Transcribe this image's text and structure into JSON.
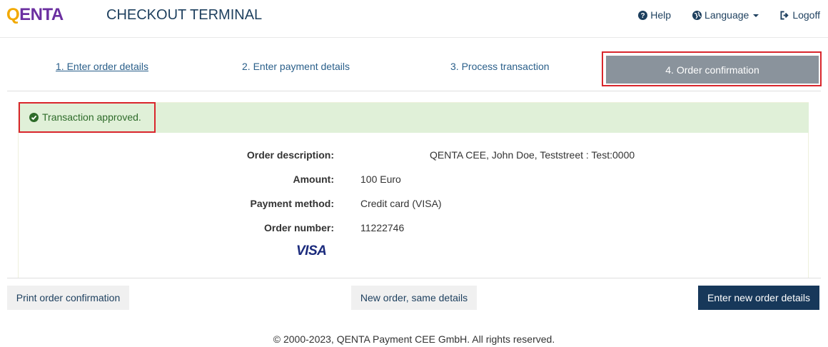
{
  "brand": {
    "logo_q": "Q",
    "logo_rest": "ENTA",
    "title": "CHECKOUT TERMINAL"
  },
  "nav": {
    "help": {
      "label": "Help",
      "icon": "question-circle-icon"
    },
    "language": {
      "label": "Language",
      "icon": "globe-icon"
    },
    "logoff": {
      "label": "Logoff",
      "icon": "sign-out-icon"
    }
  },
  "steps": [
    {
      "label": "1. Enter order details",
      "state": "done"
    },
    {
      "label": "2. Enter payment details",
      "state": "pending"
    },
    {
      "label": "3. Process transaction",
      "state": "pending"
    },
    {
      "label": "4. Order confirmation",
      "state": "active"
    }
  ],
  "alert": {
    "text": "Transaction approved.",
    "icon": "check-circle-icon",
    "color": "#2e6b2a"
  },
  "details": [
    {
      "label": "Order description:",
      "value": "QENTA CEE, John Doe, Teststreet : Test:0000"
    },
    {
      "label": "Amount:",
      "value": "100 Euro"
    },
    {
      "label": "Payment method:",
      "value": "Credit card (VISA)"
    },
    {
      "label": "Order number:",
      "value": "11222746"
    }
  ],
  "card_logo": "VISA",
  "buttons": {
    "print": "Print order confirmation",
    "same": "New order, same details",
    "new": "Enter new order details"
  },
  "copyright": "© 2000-2023, QENTA Payment CEE GmbH. All rights reserved.",
  "colors": {
    "primary": "#17385a",
    "active_step": "#8a939c",
    "alert_bg": "#e0f0d8",
    "highlight": "#d9262c"
  }
}
